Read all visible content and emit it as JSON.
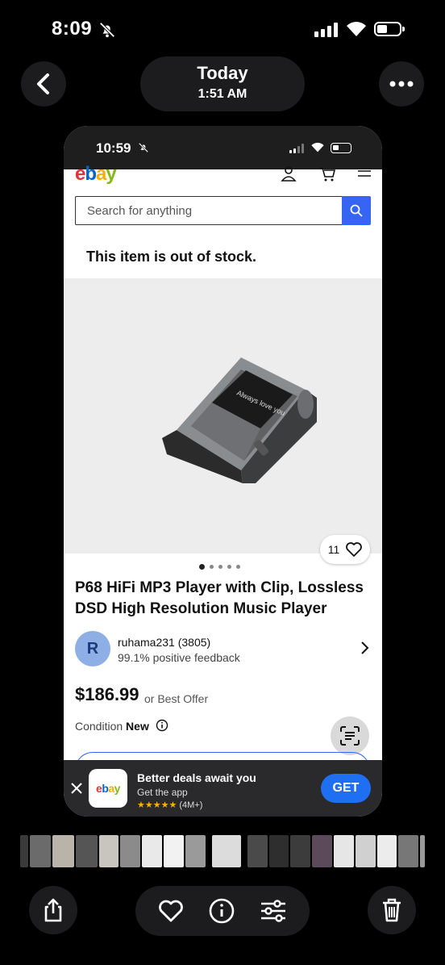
{
  "status_bar": {
    "time": "8:09"
  },
  "nav": {
    "date_day": "Today",
    "date_time": "1:51 AM"
  },
  "screenshot": {
    "status_time": "10:59",
    "search": {
      "placeholder": "Search for anything"
    },
    "out_of_stock": "This item is out of stock.",
    "product_screen_text": "Always love you",
    "watch_count": "11",
    "gallery_dots": 5,
    "gallery_active_index": 0,
    "title": "P68 HiFi MP3 Player with Clip, Lossless DSD High Resolution Music Player",
    "seller": {
      "initial": "R",
      "name": "ruhama231 (3805)",
      "feedback": "99.1% positive feedback"
    },
    "price": "$186.99",
    "best_offer": "or Best Offer",
    "condition_label": "Condition",
    "condition_value": "New",
    "app_banner": {
      "title": "Better deals await you",
      "subtitle": "Get the app",
      "rating_count": "(4M+)",
      "get_label": "GET"
    },
    "ebay_logo": {
      "e": "e",
      "b": "b",
      "a": "a",
      "y": "y"
    }
  },
  "colors": {
    "ebay_blue": "#3665f3",
    "get_button": "#1f6ff2"
  },
  "icons": [
    "bell-slash-icon",
    "signal-icon",
    "wifi-icon",
    "battery-icon",
    "back-chevron-icon",
    "more-dots-icon",
    "search-icon",
    "user-icon",
    "cart-icon",
    "menu-icon",
    "heart-icon",
    "chevron-right-icon",
    "info-icon",
    "live-text-icon",
    "close-icon",
    "share-icon",
    "favorite-icon",
    "info-circle-icon",
    "adjust-icon",
    "trash-icon"
  ]
}
